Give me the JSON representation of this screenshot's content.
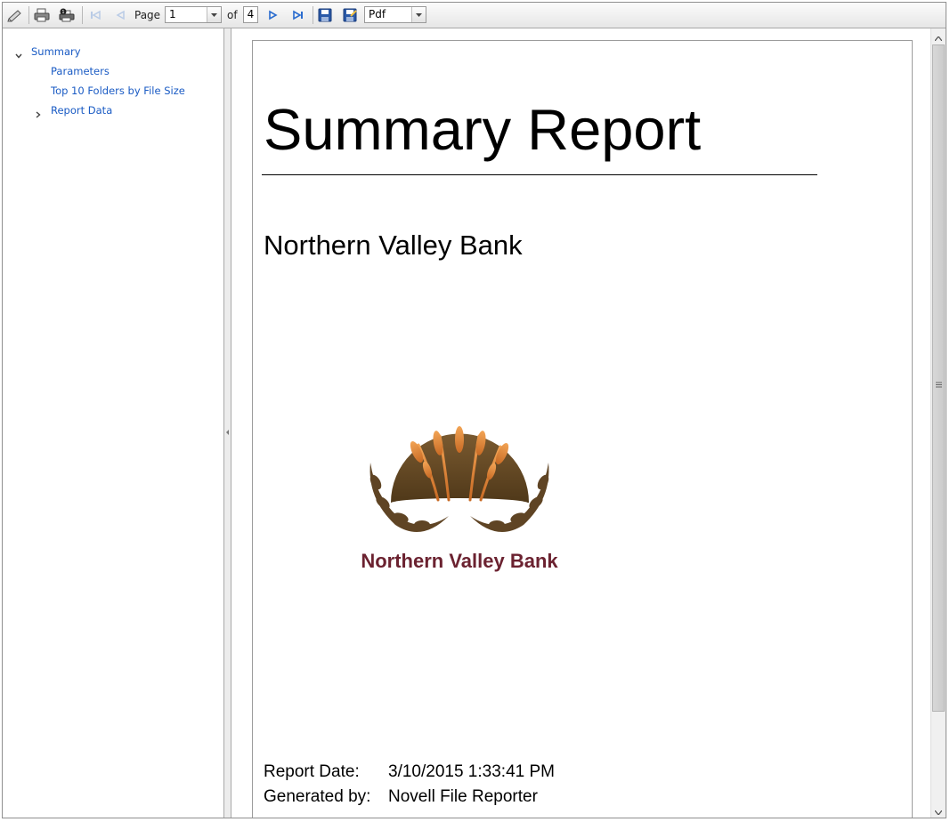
{
  "toolbar": {
    "page_label": "Page",
    "page_value": "1",
    "of_label": "of",
    "page_total": "4",
    "export_format": "Pdf",
    "icons": [
      "edit-icon",
      "print-icon",
      "print-setup-icon",
      "first-page-icon",
      "prev-page-icon",
      "next-page-icon",
      "last-page-icon",
      "save-icon",
      "save-as-icon"
    ]
  },
  "document_map": {
    "items": [
      {
        "label": "Summary",
        "state": "expanded"
      },
      {
        "label": "Parameters"
      },
      {
        "label": "Top 10 Folders by File Size"
      },
      {
        "label": "Report Data",
        "state": "collapsed"
      }
    ]
  },
  "report": {
    "title": "Summary Report",
    "company": "Northern Valley Bank",
    "logo_text": "Northern Valley Bank",
    "meta": [
      {
        "key": "Report Date:",
        "value": "3/10/2015 1:33:41 PM"
      },
      {
        "key": "Generated by:",
        "value": "Novell File Reporter"
      }
    ]
  },
  "colors": {
    "link": "#1a5bc4",
    "logo_brown": "#5f4424",
    "logo_text": "#6b2230",
    "wheat": "#e08a3a"
  }
}
